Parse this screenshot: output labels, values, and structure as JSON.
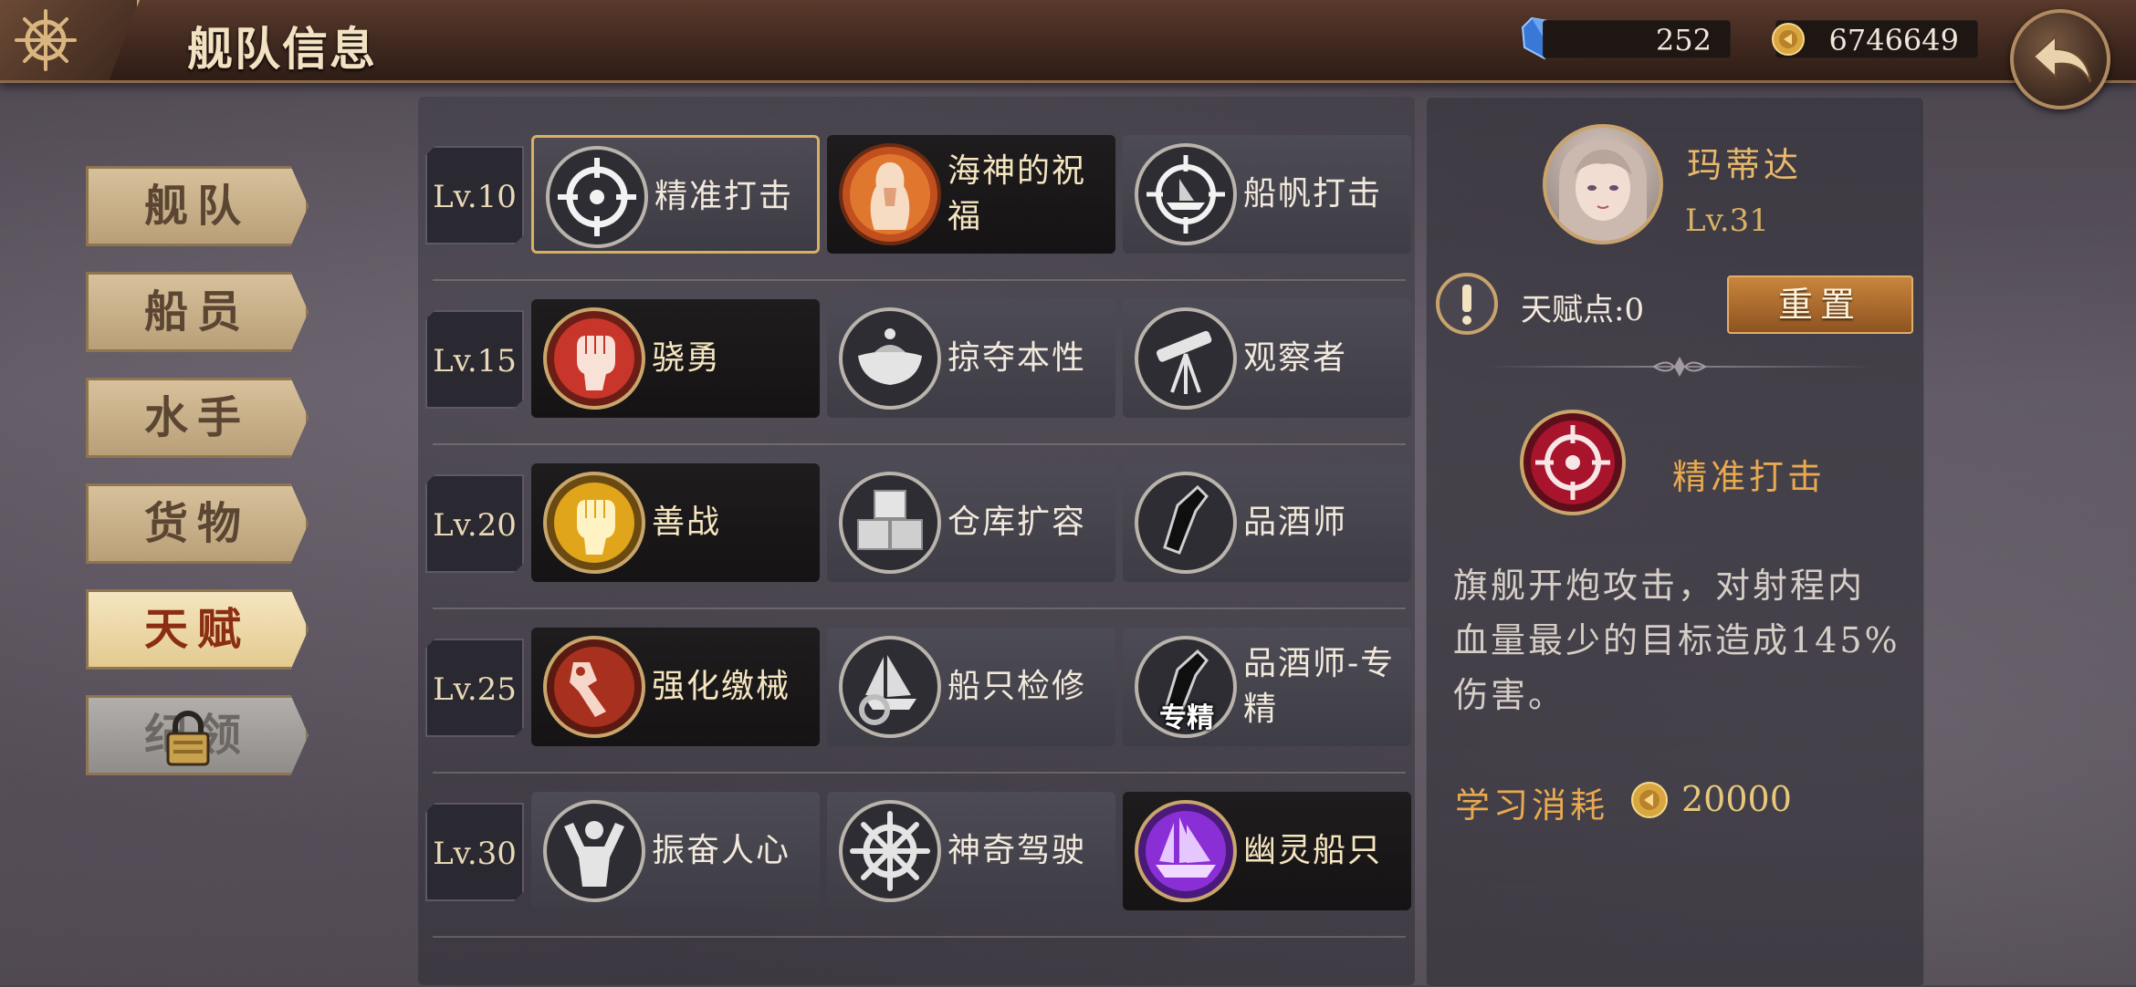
{
  "header": {
    "title": "舰队信息",
    "gems": "252",
    "coins": "6746649"
  },
  "sidebar": {
    "items": [
      {
        "label": "舰队",
        "state": "normal"
      },
      {
        "label": "船员",
        "state": "normal"
      },
      {
        "label": "水手",
        "state": "normal"
      },
      {
        "label": "货物",
        "state": "normal"
      },
      {
        "label": "天赋",
        "state": "active"
      },
      {
        "label": "纪领",
        "state": "locked"
      }
    ]
  },
  "talents": {
    "rows": [
      {
        "level": "Lv.10",
        "skills": [
          {
            "name": "精准打击",
            "icon": "crosshair-icon",
            "selected": true
          },
          {
            "name": "海神的祝福",
            "icon": "sea-god-icon"
          },
          {
            "name": "船帆打击",
            "icon": "sail-target-icon"
          }
        ]
      },
      {
        "level": "Lv.15",
        "skills": [
          {
            "name": "骁勇",
            "icon": "red-fist-icon"
          },
          {
            "name": "掠夺本性",
            "icon": "loot-bowl-icon"
          },
          {
            "name": "观察者",
            "icon": "telescope-icon"
          }
        ]
      },
      {
        "level": "Lv.20",
        "skills": [
          {
            "name": "善战",
            "icon": "gold-fist-icon"
          },
          {
            "name": "仓库扩容",
            "icon": "crates-icon"
          },
          {
            "name": "品酒师",
            "icon": "wine-bottle-icon"
          }
        ]
      },
      {
        "level": "Lv.25",
        "skills": [
          {
            "name": "强化缴械",
            "icon": "broken-blade-icon"
          },
          {
            "name": "船只检修",
            "icon": "ship-gear-icon"
          },
          {
            "name": "品酒师-专精",
            "icon": "wine-bottle-specialty-icon",
            "badge": "专精"
          }
        ]
      },
      {
        "level": "Lv.30",
        "skills": [
          {
            "name": "振奋人心",
            "icon": "inspire-icon"
          },
          {
            "name": "神奇驾驶",
            "icon": "helm-icon"
          },
          {
            "name": "幽灵船只",
            "icon": "ghost-ship-icon"
          }
        ]
      }
    ]
  },
  "detail": {
    "captain_name": "玛蒂达",
    "captain_level": "Lv.31",
    "talent_points": "天赋点:0",
    "reset_label": "重置",
    "selected_skill": "精准打击",
    "description": "旗舰开炮攻击，对射程内血量最少的目标造成145%伤害。",
    "cost_label": "学习消耗",
    "cost_value": "20000"
  },
  "colors": {
    "accent_gold": "#e8a94f",
    "selected_border": "#d7b162",
    "reset_button": "#b8743a",
    "header_brown": "#3e271e"
  }
}
